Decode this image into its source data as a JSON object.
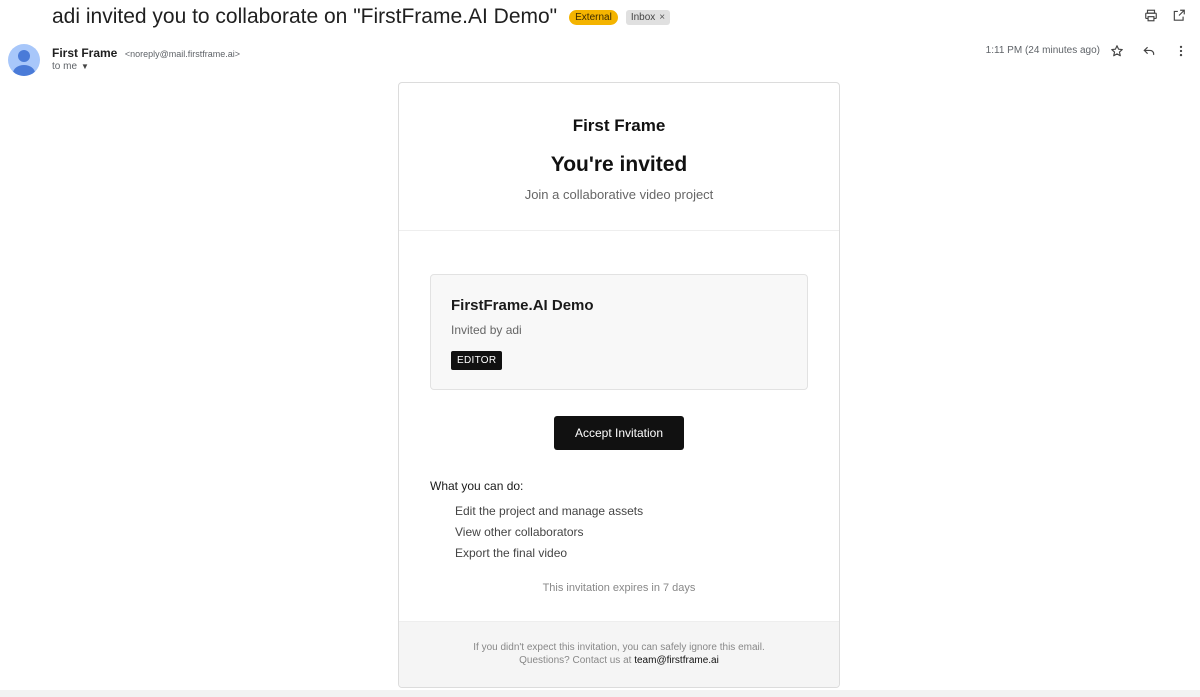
{
  "subject": {
    "text": "adi invited you to collaborate on \"FirstFrame.AI Demo\"",
    "badge_external": "External",
    "badge_inbox": "Inbox",
    "badge_inbox_close": "×"
  },
  "toolbar_icons": [
    "print-icon",
    "open-in-new-window-icon"
  ],
  "sender": {
    "name": "First Frame",
    "email": "<noreply@mail.firstframe.ai>",
    "to": "to me",
    "time": "1:11 PM (24 minutes ago)",
    "actions": [
      "star-icon",
      "reply-icon",
      "more-vert-icon"
    ]
  },
  "email": {
    "brand": "First Frame",
    "headline": "You're invited",
    "subline": "Join a collaborative video project",
    "project": {
      "name": "FirstFrame.AI Demo",
      "invited_by": "Invited by adi",
      "role": "EDITOR"
    },
    "accept_label": "Accept Invitation",
    "can_do_title": "What you can do:",
    "can_do": [
      "Edit the project and manage assets",
      "View other collaborators",
      "Export the final video"
    ],
    "expires": "This invitation expires in 7 days",
    "footer": {
      "line1": "If you didn't expect this invitation, you can safely ignore this email.",
      "line2_prefix": "Questions? Contact us at ",
      "contact_email": "team@firstframe.ai"
    }
  },
  "colors": {
    "external_badge": "#f4b400",
    "avatar_bg": "#a8c7fa",
    "button_bg": "#111111"
  }
}
